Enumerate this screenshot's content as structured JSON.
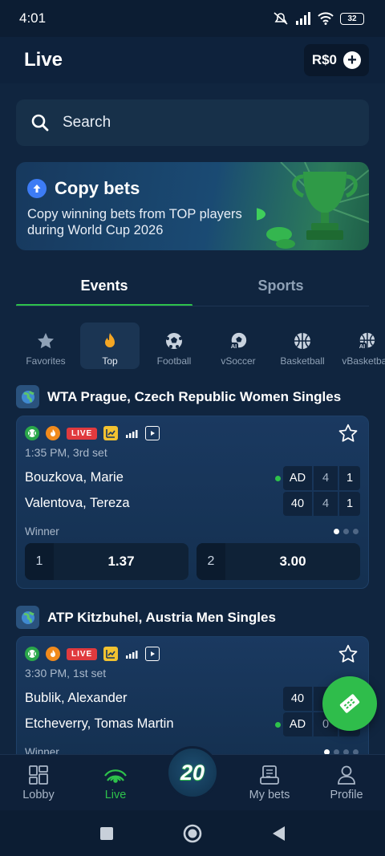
{
  "status_bar": {
    "time": "4:01",
    "battery": "32"
  },
  "header": {
    "title": "Live",
    "balance": "R$0"
  },
  "search": {
    "placeholder": "Search"
  },
  "banner": {
    "title": "Copy bets",
    "subtitle": "Copy winning bets from TOP players during World Cup 2026"
  },
  "tabs": [
    {
      "label": "Events",
      "active": true
    },
    {
      "label": "Sports",
      "active": false
    }
  ],
  "categories": [
    {
      "label": "Favorites",
      "icon": "star-icon"
    },
    {
      "label": "Top",
      "icon": "flame-icon",
      "active": true
    },
    {
      "label": "Football",
      "icon": "football-icon"
    },
    {
      "label": "vSoccer",
      "icon": "vsoccer-icon"
    },
    {
      "label": "Basketball",
      "icon": "basketball-icon"
    },
    {
      "label": "vBasketball",
      "icon": "vbasketball-icon"
    }
  ],
  "events": [
    {
      "league": "WTA Prague, Czech Republic Women Singles",
      "live_label": "LIVE",
      "time": "1:35 PM, 3rd set",
      "teams": [
        {
          "name": "Bouzkova, Marie",
          "scores": [
            "AD",
            "4",
            "1"
          ],
          "serving": true
        },
        {
          "name": "Valentova, Tereza",
          "scores": [
            "40",
            "4",
            "1"
          ],
          "serving": false
        }
      ],
      "market": "Winner",
      "odds": [
        {
          "label": "1",
          "value": "1.37"
        },
        {
          "label": "2",
          "value": "3.00"
        }
      ]
    },
    {
      "league": "ATP Kitzbuhel, Austria Men Singles",
      "live_label": "LIVE",
      "time": "3:30 PM, 1st set",
      "teams": [
        {
          "name": "Bublik, Alexander",
          "scores": [
            "40",
            "",
            ""
          ],
          "serving": false
        },
        {
          "name": "Etcheverry, Tomas Martin",
          "scores": [
            "AD",
            "0",
            ""
          ],
          "serving": true
        }
      ],
      "market": "Winner"
    }
  ],
  "bottom_nav": [
    {
      "label": "Lobby",
      "icon": "lobby-icon"
    },
    {
      "label": "Live",
      "icon": "live-icon",
      "active": true
    },
    {
      "label": "20",
      "icon": "twenty-badge"
    },
    {
      "label": "My bets",
      "icon": "my-bets-icon"
    },
    {
      "label": "Profile",
      "icon": "profile-icon"
    }
  ],
  "colors": {
    "accent": "#2ec24b",
    "live": "#e03a3e",
    "background": "#0c1d33"
  }
}
